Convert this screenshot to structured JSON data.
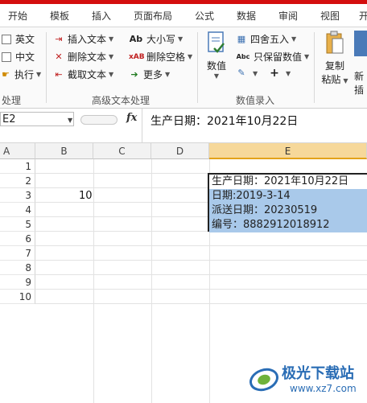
{
  "tabs": [
    "开始",
    "模板",
    "插入",
    "页面布局",
    "公式",
    "数据",
    "审阅",
    "视图",
    "开"
  ],
  "ribbon": {
    "left_group": {
      "items": [
        "英文",
        "中文",
        "执行"
      ],
      "label": "处理"
    },
    "text_group": {
      "items": [
        "插入文本",
        "删除文本",
        "截取文本",
        "大小写",
        "删除空格",
        "更多"
      ],
      "label": "高级文本处理"
    },
    "number_group": {
      "big_label": "数值",
      "items": [
        "四舍五入",
        "只保留数值"
      ],
      "label": "数值录入"
    },
    "paste_group": {
      "copy_label": "复制",
      "paste_label": "粘贴",
      "insert_label": "新插"
    }
  },
  "formula_bar": {
    "name_box": "E2",
    "fx": "fx",
    "content": "生产日期：2021年10月22日"
  },
  "columns": [
    "A",
    "B",
    "C",
    "D",
    "E"
  ],
  "rows": [
    "1",
    "2",
    "3",
    "4",
    "5",
    "6",
    "7",
    "8",
    "9",
    "10"
  ],
  "cells": {
    "B3": "10",
    "E2": "生产日期：2021年10月22日",
    "E3": "日期:2019-3-14",
    "E4": "派送日期：20230519",
    "E5": "编号：8882912018912"
  },
  "watermark": {
    "title": "极光下载站",
    "url": "www.xz7.com"
  },
  "colors": {
    "accent": "#d40e0e",
    "selection_highlight": "#a9c9ea",
    "active_header": "#f6d89a"
  }
}
